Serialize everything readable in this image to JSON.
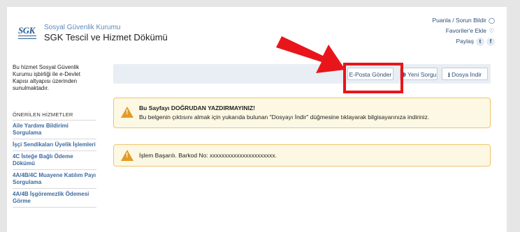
{
  "header": {
    "org_name": "Sosyal Güvenlik Kurumu",
    "app_title": "SGK Tescil ve Hizmet Dökümü",
    "logo_text": "SGK",
    "links": {
      "feedback": "Puanla / Sorun Bildir",
      "favorite": "Favoriler'e Ekle",
      "share": "Paylaş"
    }
  },
  "sidebar": {
    "info": "Bu hizmet Sosyal Güvenlik Kurumu işbirliği ile e-Devlet Kapısı altyapısı üzerinden sunulmaktadır.",
    "heading": "ÖNERİLEN HİZMETLER",
    "items": [
      {
        "label": "Aile Yardımı Bildirimi Sorgulama"
      },
      {
        "label": "İşçi Sendikaları Üyelik İşlemleri"
      },
      {
        "label": "4C İsteğe Bağlı Ödeme Dökümü"
      },
      {
        "label": "4A/4B/4C Muayene Katılım Payı Sorgulama"
      },
      {
        "label": "4A/4B İşgöremezlik Ödemesi Görme"
      }
    ]
  },
  "toolbar": {
    "email_label": "E-Posta Gönder",
    "new_query_label": "Yeni Sorgu",
    "download_label": "Dosya İndir"
  },
  "alerts": {
    "warning_title": "Bu Sayfayı DOĞRUDAN YAZDIRMAYINIZ!",
    "warning_text": "Bu belgenin çıktısını almak için yukarıda bulunan \"Dosyayı İndir\" düğmesine tıklayarak bilgisayarınıza indiriniz.",
    "barcode_text": "İşlem Başarılı. Barkod No: xxxxxxxxxxxxxxxxxxxxxx."
  },
  "colors": {
    "annotation_red": "#e8161b",
    "link_blue": "#3c6aa0",
    "warning_orange": "#e29b28",
    "alert_bg": "#fcf8e3"
  }
}
